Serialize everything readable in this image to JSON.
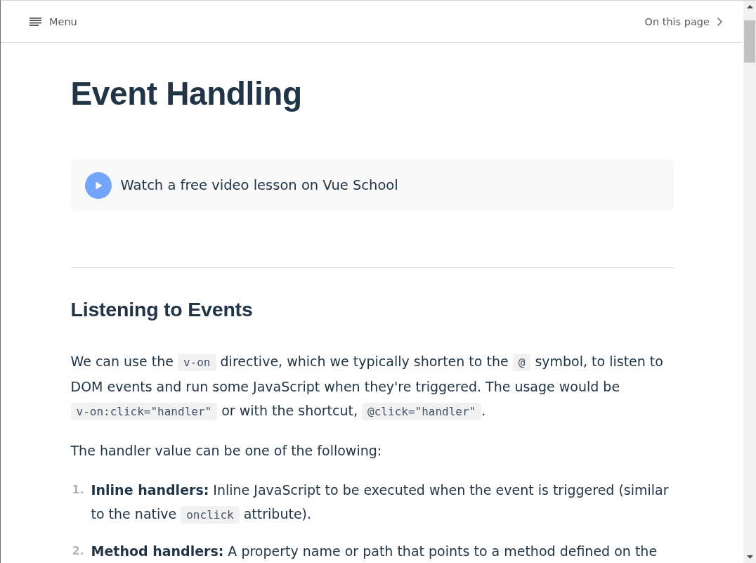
{
  "nav": {
    "menu_label": "Menu",
    "outline_label": "On this page"
  },
  "title": "Event Handling",
  "video_callout": {
    "label": "Watch a free video lesson on Vue School"
  },
  "sections": [
    {
      "heading": "Listening to Events",
      "blocks": [
        {
          "kind": "paragraph",
          "segments": [
            {
              "kind": "text",
              "text": "We can use the "
            },
            {
              "kind": "code",
              "text": "v-on"
            },
            {
              "kind": "text",
              "text": " directive, which we typically shorten to the "
            },
            {
              "kind": "code",
              "text": "@"
            },
            {
              "kind": "text",
              "text": " symbol, to listen to DOM events and run some JavaScript when they're triggered. The usage would be "
            },
            {
              "kind": "code",
              "text": "v-on:click=\"handler\""
            },
            {
              "kind": "text",
              "text": " or with the shortcut, "
            },
            {
              "kind": "code",
              "text": "@click=\"handler\""
            },
            {
              "kind": "text",
              "text": "."
            }
          ]
        },
        {
          "kind": "paragraph",
          "segments": [
            {
              "kind": "text",
              "text": "The handler value can be one of the following:"
            }
          ]
        },
        {
          "kind": "ordered_list",
          "items": [
            {
              "number": "1.",
              "segments": [
                {
                  "kind": "text",
                  "text": "**Inline handlers:** Inline JavaScript to be executed when the event is triggered (similar to the native "
                },
                {
                  "kind": "code",
                  "text": "onclick"
                },
                {
                  "kind": "text",
                  "text": " attribute)."
                }
              ]
            },
            {
              "number": "2.",
              "segments": [
                {
                  "kind": "text",
                  "text": "**Method handlers:** A property name or path that points to a method defined on the"
                }
              ]
            }
          ]
        }
      ]
    }
  ]
}
